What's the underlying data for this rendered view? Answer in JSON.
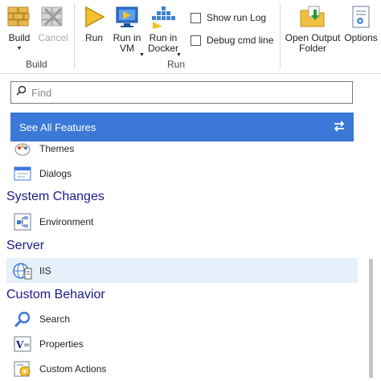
{
  "ribbon": {
    "groups": {
      "build": "Build",
      "run": "Run"
    },
    "buttons": {
      "build": "Build",
      "cancel": "Cancel",
      "run": "Run",
      "run_in_vm": "Run in VM",
      "run_in_docker": "Run in Docker",
      "open_output_folder": "Open Output Folder",
      "options": "Options"
    },
    "checkboxes": {
      "show_run_log": "Show run Log",
      "debug_cmd_line": "Debug cmd line"
    }
  },
  "search": {
    "placeholder": "Find",
    "value": ""
  },
  "see_all": {
    "label": "See All Features",
    "icon": "swap-arrows-icon"
  },
  "features": {
    "items_top": [
      {
        "label": "Themes",
        "icon": "themes-icon"
      },
      {
        "label": "Dialogs",
        "icon": "dialogs-icon"
      }
    ],
    "system_changes": {
      "title": "System Changes",
      "items": [
        {
          "label": "Environment",
          "icon": "environment-icon"
        }
      ]
    },
    "server": {
      "title": "Server",
      "items": [
        {
          "label": "IIS",
          "icon": "iis-icon",
          "selected": true
        }
      ]
    },
    "custom_behavior": {
      "title": "Custom Behavior",
      "items": [
        {
          "label": "Search",
          "icon": "search-icon"
        },
        {
          "label": "Properties",
          "icon": "properties-icon"
        },
        {
          "label": "Custom Actions",
          "icon": "custom-actions-icon"
        }
      ]
    }
  },
  "colors": {
    "accent": "#3b78d8",
    "category_text": "#1a1a8c",
    "selected_row": "#e7f1fb"
  }
}
